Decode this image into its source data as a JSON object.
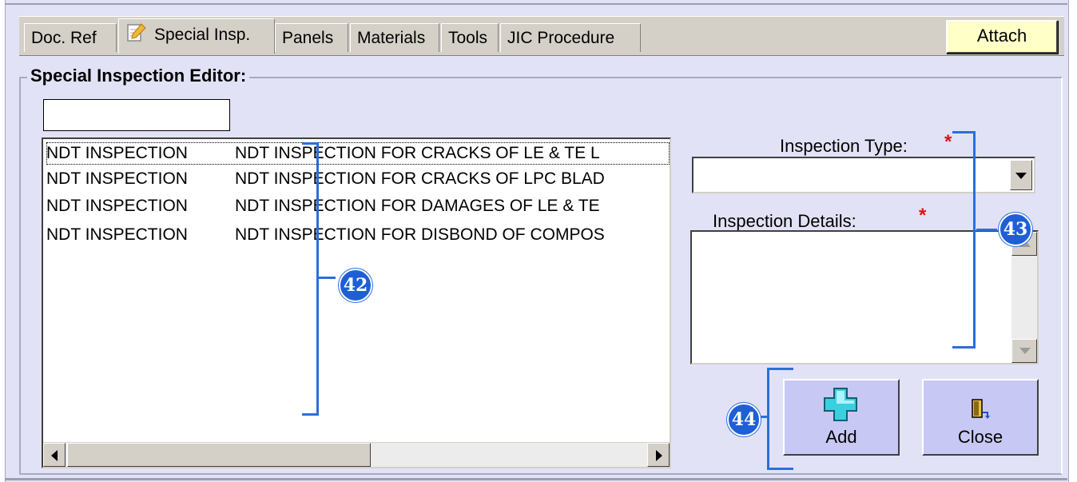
{
  "tabs": [
    {
      "label": "Doc. Ref",
      "active": false
    },
    {
      "label": "Special Insp.",
      "active": true,
      "icon": "notepad-pencil-icon"
    },
    {
      "label": "Panels",
      "active": false
    },
    {
      "label": "Materials",
      "active": false
    },
    {
      "label": "Tools",
      "active": false
    },
    {
      "label": "JIC Procedure",
      "active": false
    }
  ],
  "attach_label": "Attach",
  "editor": {
    "title": "Special Inspection Editor:",
    "search_value": "",
    "list": [
      {
        "type": "NDT INSPECTION",
        "desc": "NDT INSPECTION FOR CRACKS OF LE & TE L",
        "selected": true
      },
      {
        "type": "NDT INSPECTION",
        "desc": "NDT INSPECTION FOR CRACKS OF LPC BLAD",
        "selected": false
      },
      {
        "type": "NDT INSPECTION",
        "desc": "NDT INSPECTION FOR DAMAGES OF LE & TE",
        "selected": false
      },
      {
        "type": "NDT INSPECTION",
        "desc": "NDT INSPECTION FOR DISBOND OF COMPOS",
        "selected": false
      }
    ],
    "inspection_type_label": "Inspection Type:",
    "inspection_type_value": "",
    "inspection_details_label": "Inspection Details:",
    "inspection_details_value": "",
    "required_mark": "*",
    "add_label": "Add",
    "close_label": "Close"
  },
  "callouts": {
    "list": "42",
    "fields": "43",
    "buttons": "44"
  },
  "colors": {
    "callout_blue": "#1f5fd6",
    "required_red": "#dd1111",
    "panel_bg": "#e2e2f6",
    "attach_bg": "#ffffc8",
    "button_bg": "#c8c8f4"
  }
}
